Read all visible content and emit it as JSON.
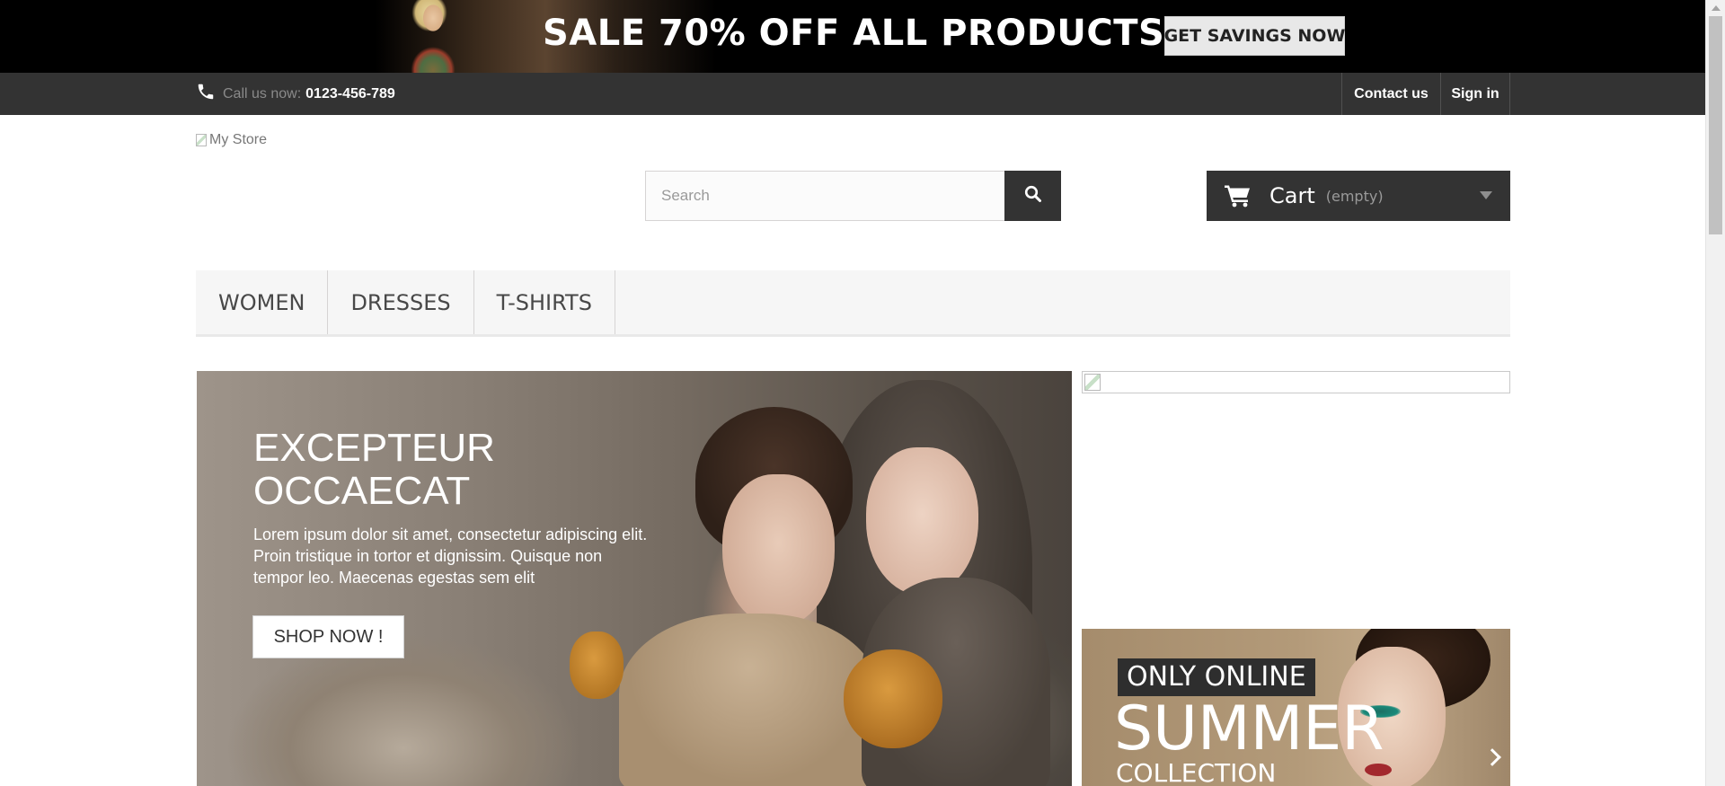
{
  "promo": {
    "text": "SALE 70% OFF ALL PRODUCTS",
    "button": "GET SAVINGS NOW"
  },
  "nav": {
    "call_label": "Call us now:",
    "phone": "0123-456-789",
    "contact": "Contact us",
    "signin": "Sign in",
    "icons": [
      "phone-icon"
    ]
  },
  "header": {
    "logo_alt": "My Store",
    "search_placeholder": "Search",
    "cart_label": "Cart",
    "cart_status": "(empty)",
    "icons": [
      "search-icon",
      "cart-icon",
      "chevron-down-icon"
    ]
  },
  "menu": {
    "items": [
      "WOMEN",
      "DRESSES",
      "T-SHIRTS"
    ]
  },
  "slider": {
    "title": "EXCEPTEUR OCCAECAT",
    "text": "Lorem ipsum dolor sit amet, consectetur adipiscing elit. Proin tristique in tortor et dignissim. Quisque non tempor leo. Maecenas egestas sem elit",
    "button": "SHOP NOW !"
  },
  "side_banner": {
    "tag": "ONLY ONLINE",
    "headline": "SUMMER",
    "subline": "COLLECTION"
  },
  "colors": {
    "dark": "#333333",
    "menu_bg": "#f6f6f6",
    "promo_bg": "#000000",
    "button_bg": "#e8e8e8"
  }
}
